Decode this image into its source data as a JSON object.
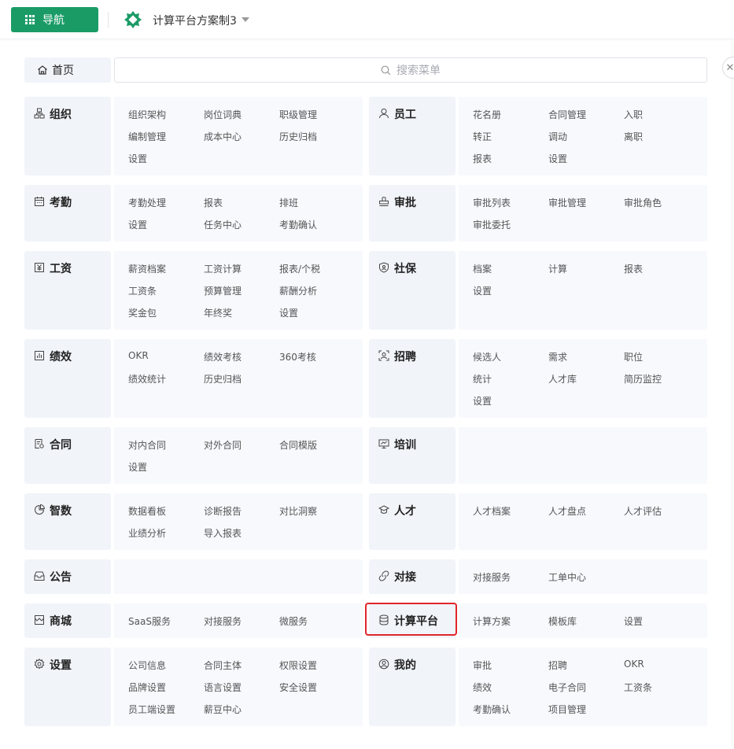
{
  "header": {
    "nav_label": "导航",
    "app_name": "计算平台方案制3"
  },
  "home_label": "首页",
  "search": {
    "placeholder": "搜索菜单"
  },
  "sections": [
    {
      "id": "org",
      "label": "组织",
      "icon": "org-chart-icon",
      "items": [
        "组织架构",
        "岗位词典",
        "职级管理",
        "编制管理",
        "成本中心",
        "历史归档",
        "设置"
      ]
    },
    {
      "id": "employee",
      "label": "员工",
      "icon": "person-icon",
      "items": [
        "花名册",
        "合同管理",
        "入职",
        "转正",
        "调动",
        "离职",
        "报表",
        "设置"
      ]
    },
    {
      "id": "attendance",
      "label": "考勤",
      "icon": "calendar-icon",
      "items": [
        "考勤处理",
        "报表",
        "排班",
        "设置",
        "任务中心",
        "考勤确认"
      ]
    },
    {
      "id": "approval",
      "label": "审批",
      "icon": "stamp-icon",
      "items": [
        "审批列表",
        "审批管理",
        "审批角色",
        "审批委托"
      ]
    },
    {
      "id": "salary",
      "label": "工资",
      "icon": "yen-icon",
      "items": [
        "薪资档案",
        "工资计算",
        "报表/个税",
        "工资条",
        "预算管理",
        "薪酬分析",
        "奖金包",
        "年终奖",
        "设置"
      ]
    },
    {
      "id": "social",
      "label": "社保",
      "icon": "shield-icon",
      "items": [
        "档案",
        "计算",
        "报表",
        "设置"
      ]
    },
    {
      "id": "performance",
      "label": "绩效",
      "icon": "bar-chart-icon",
      "items": [
        "OKR",
        "绩效考核",
        "360考核",
        "绩效统计",
        "历史归档"
      ]
    },
    {
      "id": "recruit",
      "label": "招聘",
      "icon": "scan-person-icon",
      "items": [
        "候选人",
        "需求",
        "职位",
        "统计",
        "人才库",
        "简历监控",
        "设置"
      ]
    },
    {
      "id": "contract",
      "label": "合同",
      "icon": "document-icon",
      "items": [
        "对内合同",
        "对外合同",
        "合同模版",
        "设置"
      ]
    },
    {
      "id": "training",
      "label": "培训",
      "icon": "presentation-icon",
      "items": []
    },
    {
      "id": "insight",
      "label": "智数",
      "icon": "pie-chart-icon",
      "items": [
        "数据看板",
        "诊断报告",
        "对比洞察",
        "业绩分析",
        "导入报表"
      ]
    },
    {
      "id": "talent",
      "label": "人才",
      "icon": "graduation-cap-icon",
      "items": [
        "人才档案",
        "人才盘点",
        "人才评估"
      ]
    },
    {
      "id": "notice",
      "label": "公告",
      "icon": "inbox-icon",
      "items": []
    },
    {
      "id": "integration",
      "label": "对接",
      "icon": "link-icon",
      "items": [
        "对接服务",
        "工单中心"
      ]
    },
    {
      "id": "mall",
      "label": "商城",
      "icon": "store-icon",
      "items": [
        "SaaS服务",
        "对接服务",
        "微服务"
      ]
    },
    {
      "id": "compute",
      "label": "计算平台",
      "icon": "database-icon",
      "items": [
        "计算方案",
        "模板库",
        "设置"
      ]
    },
    {
      "id": "settings",
      "label": "设置",
      "icon": "gear-icon",
      "items": [
        "公司信息",
        "合同主体",
        "权限设置",
        "品牌设置",
        "语言设置",
        "安全设置",
        "员工端设置",
        "薪豆中心"
      ]
    },
    {
      "id": "mine",
      "label": "我的",
      "icon": "user-circle-icon",
      "items": [
        "审批",
        "招聘",
        "OKR",
        "绩效",
        "电子合同",
        "工资条",
        "考勤确认",
        "项目管理"
      ]
    }
  ],
  "colors": {
    "brand": "#1a9b66",
    "highlight": "#e0262b",
    "category_bg": "#f1f4f9"
  }
}
